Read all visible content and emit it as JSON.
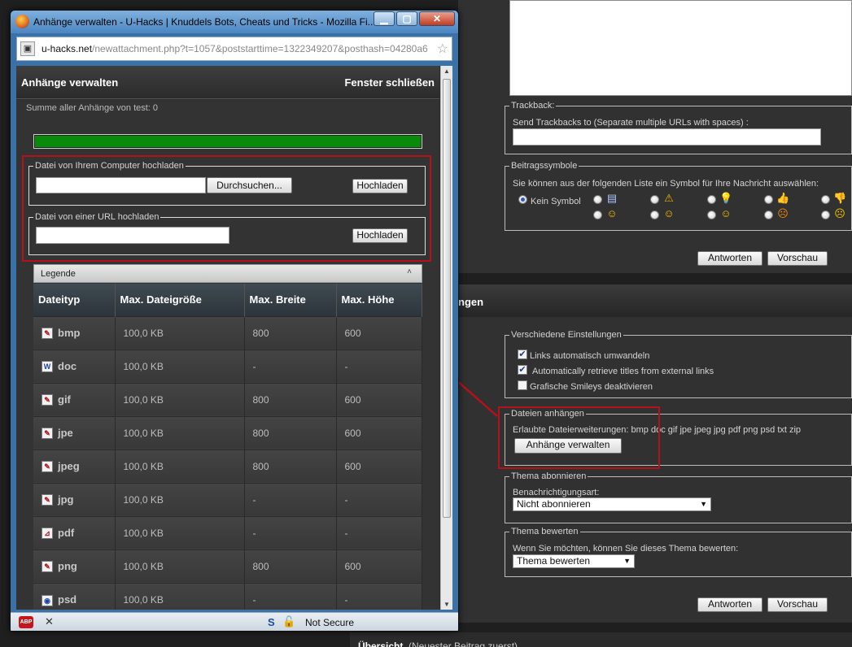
{
  "background": {
    "trackback": {
      "legend": "Trackback:",
      "label": "Send Trackbacks to (Separate multiple URLs with spaces) :"
    },
    "post_icons": {
      "legend": "Beitragssymbole",
      "instruction": "Sie können aus der folgenden Liste ein Symbol für Ihre Nachricht auswählen:",
      "none_label": "Kein Symbol"
    },
    "reply_button": "Antworten",
    "preview_button": "Vorschau",
    "options_section_title": "ngen",
    "misc_settings": {
      "legend": "Verschiedene Einstellungen",
      "opt1": "Links automatisch umwandeln",
      "opt2": "Automatically retrieve titles from external links",
      "opt3": "Grafische Smileys deaktivieren"
    },
    "attach_files": {
      "legend": "Dateien anhängen",
      "allowed": "Erlaubte Dateierweiterungen: bmp doc gif jpe jpeg jpg pdf png psd txt zip",
      "manage_button": "Anhänge verwalten"
    },
    "subscribe": {
      "legend": "Thema abonnieren",
      "label": "Benachrichtigungsart:",
      "selected": "Nicht abonnieren"
    },
    "rate": {
      "legend": "Thema bewerten",
      "label": "Wenn Sie möchten, können Sie dieses Thema bewerten:",
      "selected": "Thema bewerten"
    },
    "overview_title": "Übersicht",
    "overview_sub": "(Neuester Beitrag zuerst)"
  },
  "popup": {
    "window_title": "Anhänge verwalten - U-Hacks | Knuddels Bots, Cheats und Tricks - Mozilla Fi...",
    "url_host": "u-hacks.net",
    "url_rest": "/newattachment.php?t=1057&poststarttime=1322349207&posthash=04280a6",
    "header_title": "Anhänge verwalten",
    "close_link": "Fenster schließen",
    "sum_label": "Summe aller Anhänge von test: 0",
    "progress_fraction": 1.0,
    "upload_computer": {
      "legend": "Datei von Ihrem Computer hochladen",
      "browse_button": "Durchsuchen...",
      "upload_button": "Hochladen"
    },
    "upload_url": {
      "legend": "Datei von einer URL hochladen",
      "upload_button": "Hochladen"
    },
    "legend_bar_label": "Legende",
    "table": {
      "headers": [
        "Dateityp",
        "Max. Dateigröße",
        "Max. Breite",
        "Max. Höhe"
      ],
      "rows": [
        {
          "type": "bmp",
          "size": "100,0 KB",
          "width": "800",
          "height": "600",
          "icon": "image-file-icon"
        },
        {
          "type": "doc",
          "size": "100,0 KB",
          "width": "-",
          "height": "-",
          "icon": "word-file-icon"
        },
        {
          "type": "gif",
          "size": "100,0 KB",
          "width": "800",
          "height": "600",
          "icon": "image-file-icon"
        },
        {
          "type": "jpe",
          "size": "100,0 KB",
          "width": "800",
          "height": "600",
          "icon": "image-file-icon"
        },
        {
          "type": "jpeg",
          "size": "100,0 KB",
          "width": "800",
          "height": "600",
          "icon": "image-file-icon"
        },
        {
          "type": "jpg",
          "size": "100,0 KB",
          "width": "-",
          "height": "-",
          "icon": "image-file-icon"
        },
        {
          "type": "pdf",
          "size": "100,0 KB",
          "width": "-",
          "height": "-",
          "icon": "pdf-file-icon"
        },
        {
          "type": "png",
          "size": "100,0 KB",
          "width": "800",
          "height": "600",
          "icon": "image-file-icon"
        },
        {
          "type": "psd",
          "size": "100,0 KB",
          "width": "-",
          "height": "-",
          "icon": "psd-file-icon"
        }
      ]
    },
    "status_text": "Not Secure",
    "abp_label": "ABP"
  },
  "colors": {
    "highlight_red": "#b3121c",
    "progress_green": "#0a8a0a",
    "titlebar_blue": "#4c86c2"
  }
}
